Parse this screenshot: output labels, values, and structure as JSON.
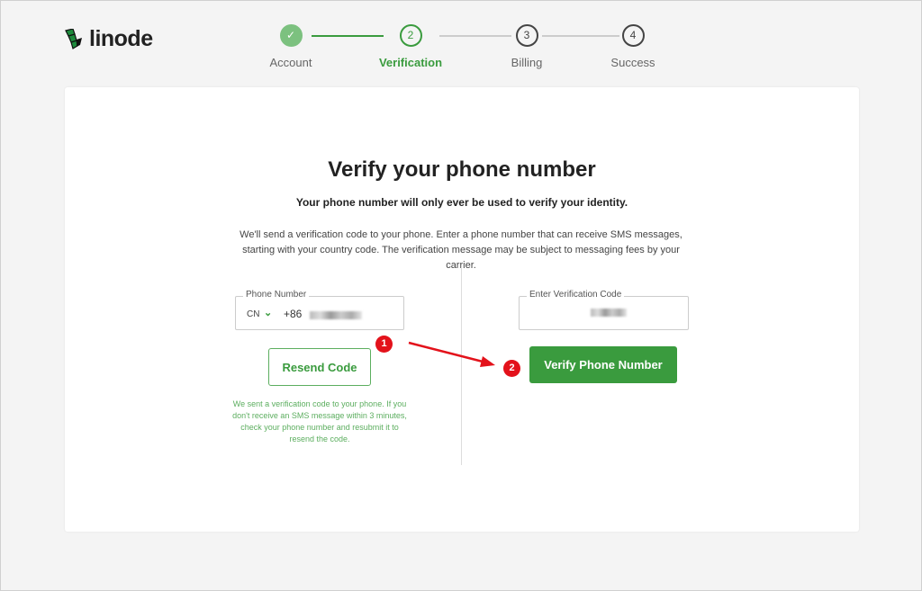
{
  "brand": {
    "name": "linode",
    "color": "#3a9b3e"
  },
  "stepper": {
    "steps": [
      {
        "number": "✓",
        "label": "Account",
        "state": "done"
      },
      {
        "number": "2",
        "label": "Verification",
        "state": "active"
      },
      {
        "number": "3",
        "label": "Billing",
        "state": "pending"
      },
      {
        "number": "4",
        "label": "Success",
        "state": "pending"
      }
    ]
  },
  "main": {
    "title": "Verify your phone number",
    "subtitle": "Your phone number will only ever be used to verify your identity.",
    "description": "We'll send a verification code to your phone. Enter a phone number that can receive SMS messages, starting with your country code. The verification message may be subject to messaging fees by your carrier.",
    "phone": {
      "label": "Phone Number",
      "country": "CN",
      "dial_code": "+86"
    },
    "resend_label": "Resend Code",
    "resend_note": "We sent a verification code to your phone. If you don't receive an SMS message within 3 minutes, check your phone number and resubmit it to resend the code.",
    "code": {
      "label": "Enter Verification Code"
    },
    "verify_label": "Verify Phone Number"
  },
  "annotations": {
    "badge1": "1",
    "badge2": "2",
    "color": "#e3121b"
  }
}
